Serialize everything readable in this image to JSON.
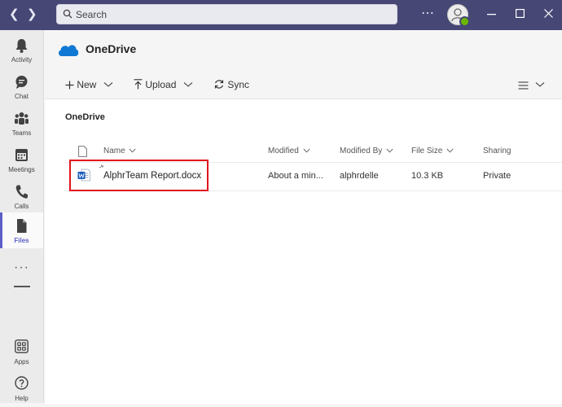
{
  "titlebar": {
    "search_placeholder": "Search"
  },
  "rail": {
    "items": [
      {
        "label": "Activity",
        "icon": "bell-icon"
      },
      {
        "label": "Chat",
        "icon": "chat-icon"
      },
      {
        "label": "Teams",
        "icon": "teams-icon"
      },
      {
        "label": "Meetings",
        "icon": "calendar-icon"
      },
      {
        "label": "Calls",
        "icon": "phone-icon"
      },
      {
        "label": "Files",
        "icon": "file-icon",
        "active": true
      },
      {
        "label": "Apps",
        "icon": "apps-icon"
      },
      {
        "label": "Help",
        "icon": "help-icon"
      }
    ],
    "more": "···"
  },
  "header": {
    "title": "OneDrive"
  },
  "toolbar": {
    "new_label": "New",
    "upload_label": "Upload",
    "sync_label": "Sync"
  },
  "files": {
    "section_title": "OneDrive",
    "columns": [
      "Name",
      "Modified",
      "Modified By",
      "File Size",
      "Sharing"
    ],
    "rows": [
      {
        "name": "AlphrTeam Report.docx",
        "modified": "About a min...",
        "modified_by": "alphrdelle",
        "size": "10.3 KB",
        "sharing": "Private"
      }
    ]
  },
  "colors": {
    "titlebar": "#464775",
    "accent": "#5b5fc7",
    "highlight": "#e0141c",
    "word": "#185abd",
    "onedrive": "#0f78d4"
  }
}
